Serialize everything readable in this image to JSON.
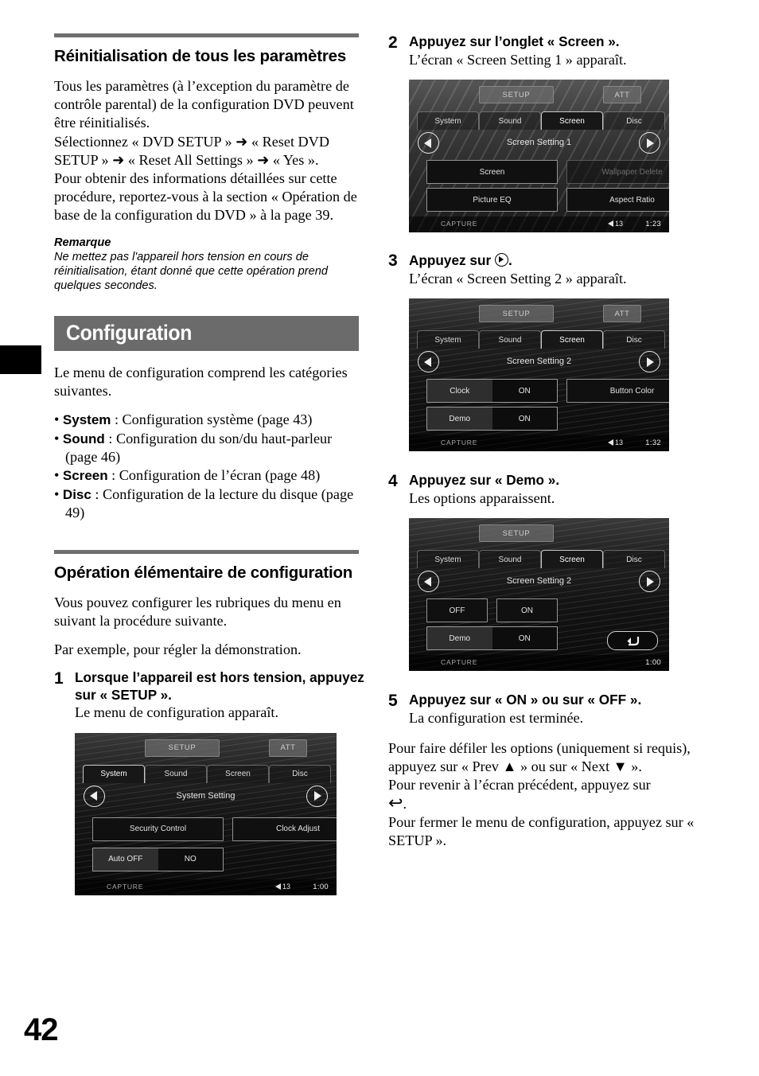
{
  "page": {
    "number": "42"
  },
  "left": {
    "heading": "Réinitialisation de tous les paramètres",
    "para1": "Tous les paramètres (à l’exception du paramètre de contrôle parental) de la configuration DVD peuvent être réinitialisés.",
    "para2_a": "Sélectionnez « DVD SETUP »",
    "para2_b": "« Reset DVD SETUP »",
    "para2_c": "« Reset All Settings »",
    "para2_d": "« Yes ».",
    "para3": "Pour obtenir des informations détaillées sur cette procédure, reportez-vous à la section « Opération de base de la configuration du DVD » à la page 39.",
    "note_title": "Remarque",
    "note_body": "Ne mettez pas l'appareil hors tension en cours de réinitialisation, étant donné que cette opération prend quelques secondes.",
    "banner": "Configuration",
    "intro": "Le menu de configuration comprend les catégories suivantes.",
    "categories": [
      {
        "name": "System",
        "desc": " : Configuration système (page 43)"
      },
      {
        "name": "Sound",
        "desc": " : Configuration du son/du haut-parleur (page 46)"
      },
      {
        "name": "Screen",
        "desc": " : Configuration de l’écran (page 48)"
      },
      {
        "name": "Disc",
        "desc": " : Configuration de la lecture du disque (page 49)"
      }
    ],
    "heading2": "Opération élémentaire de configuration",
    "para4": "Vous pouvez configurer les rubriques du menu en suivant la procédure suivante.",
    "para5": "Par exemple, pour régler la démonstration.",
    "step1": {
      "num": "1",
      "title": "Lorsque l’appareil est hors tension, appuyez sur « SETUP ».",
      "sub": "Le menu de configuration apparaît."
    }
  },
  "right": {
    "step2": {
      "num": "2",
      "title": "Appuyez sur l’onglet « Screen ».",
      "sub": "L’écran « Screen Setting 1 » apparaît."
    },
    "step3": {
      "num": "3",
      "title_a": "Appuyez sur",
      "title_b": ".",
      "sub": "L’écran « Screen Setting 2 » apparaît."
    },
    "step4": {
      "num": "4",
      "title": "Appuyez sur « Demo ».",
      "sub": "Les options apparaissent."
    },
    "step5": {
      "num": "5",
      "title": "Appuyez sur « ON » ou sur « OFF ».",
      "sub": "La configuration est terminée."
    },
    "closing_a": "Pour faire défiler les options (uniquement si requis), appuyez sur « Prev ▲ » ou sur « Next ▼ ».",
    "closing_b": "Pour revenir à l’écran précédent, appuyez sur",
    "closing_b_end": ".",
    "closing_c": "Pour fermer le menu de configuration, appuyez sur « SETUP »."
  },
  "devices": {
    "common": {
      "setup_label": "SETUP",
      "att_label": "ATT",
      "capture_label": "CAPTURE",
      "tabs": [
        "System",
        "Sound",
        "Screen",
        "Disc"
      ]
    },
    "d1": {
      "active_tab": "System",
      "title": "System Setting",
      "btn_left_top": "Security Control",
      "btn_right_top": "Clock Adjust",
      "toggle_label": "Auto OFF",
      "toggle_value": "NO",
      "volume": "13",
      "time": "1:00",
      "att_visible": true
    },
    "d2": {
      "active_tab": "Screen",
      "title": "Screen Setting 1",
      "btn_left_top": "Screen",
      "btn_right_top": "Wallpaper Delete",
      "btn_left_bottom": "Picture EQ",
      "btn_right_bottom": "Aspect Ratio",
      "volume": "13",
      "time": "1:23",
      "att_visible": true
    },
    "d3": {
      "active_tab": "Screen",
      "title": "Screen Setting 2",
      "toggle1_label": "Clock",
      "toggle1_value": "ON",
      "btn_right_top": "Button Color",
      "toggle2_label": "Demo",
      "toggle2_value": "ON",
      "volume": "13",
      "time": "1:32",
      "att_visible": true
    },
    "d4": {
      "active_tab": "Screen",
      "title": "Screen Setting 2",
      "opt_off": "OFF",
      "opt_on": "ON",
      "toggle2_label": "Demo",
      "toggle2_value": "ON",
      "back_icon": "back-arrow",
      "time": "1:00",
      "att_visible": false
    }
  }
}
